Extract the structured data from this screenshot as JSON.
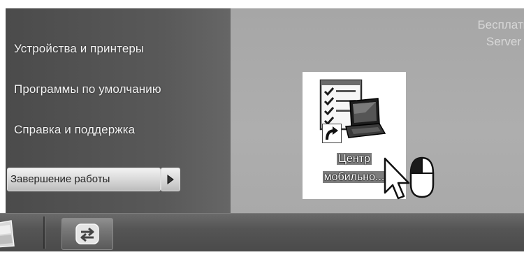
{
  "start_menu": {
    "items": [
      {
        "label": "Устройства и принтеры"
      },
      {
        "label": "Программы по умолчанию"
      },
      {
        "label": "Справка и поддержка"
      }
    ],
    "shutdown_label": "Завершение работы",
    "shutdown_arrow_icon": "triangle-right-icon"
  },
  "desktop": {
    "watermark": [
      "Бесплатн",
      "Server"
    ],
    "shortcut": {
      "label_line1": "Центр",
      "label_line2": "мобильно...",
      "icon": "mobility-center-icon",
      "overlay_icon": "shortcut-arrow-icon"
    }
  },
  "cursor": {
    "pointer_icon": "arrow-cursor-icon",
    "mouse_icon": "mouse-left-click-icon"
  },
  "taskbar": {
    "start_icon": "start-orb-icon",
    "pinned_icon": "switch-windows-icon"
  },
  "colors": {
    "start_menu_bg": "#555555",
    "desktop_bg": "#a9a9a9",
    "taskbar_bg": "#4f4f4f",
    "menu_text": "#f3f3f3"
  }
}
